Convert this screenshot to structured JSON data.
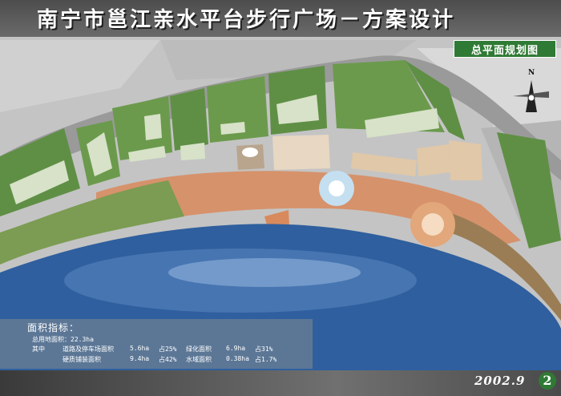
{
  "title": "南宁市邕江亲水平台步行广场－方案设计",
  "subtitle": "总平面规划图",
  "area_indicators": {
    "heading": "面积指标：",
    "total": "总用地面积：22.3ha",
    "prefix": "其中",
    "items": [
      {
        "label": "道路及停车场面积",
        "area": "5.6ha",
        "percent_label": "占25%"
      },
      {
        "label": "绿化面积",
        "area": "6.9ha",
        "percent_label": "占31%"
      },
      {
        "label": "硬质铺装面积",
        "area": "9.4ha",
        "percent_label": "占42%"
      },
      {
        "label": "水域面积",
        "area": "0.38ha",
        "percent_label": "占1.7%"
      }
    ]
  },
  "date": "2002.9",
  "page_number": "2",
  "compass_label": "N",
  "colors": {
    "accent": "#2f7a35",
    "water": "#2f5f9e",
    "grass": "#6f9a4f",
    "plaza": "#d98a5c"
  }
}
